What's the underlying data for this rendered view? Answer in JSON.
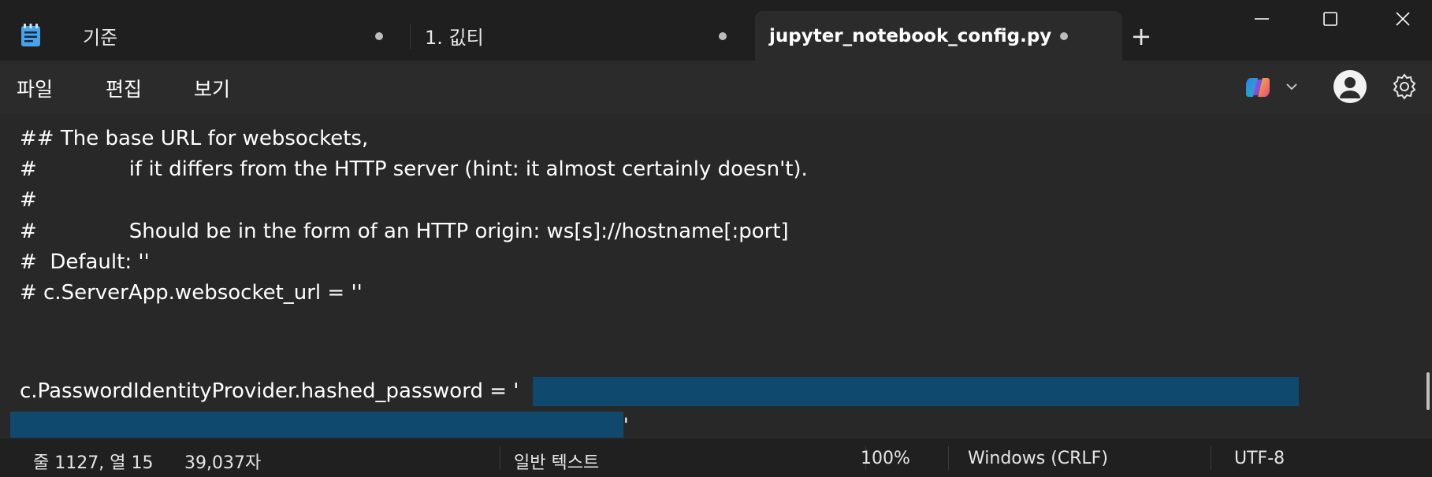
{
  "tabs": [
    {
      "label": "기준"
    },
    {
      "label": "1. 깂티"
    },
    {
      "label": "jupyter_notebook_config.py"
    }
  ],
  "new_tab_label": "+",
  "menu": {
    "file": "파일",
    "edit": "편집",
    "view": "보기"
  },
  "editor": {
    "lines": [
      "## The base URL for websockets,",
      "#",
      "if it differs from the HTTP server (hint: it almost certainly doesn't).",
      "#",
      "#",
      "Should be in the form of an HTTP origin: ws[s]://hostname[:port]",
      "#  Default: ''",
      "# c.ServerApp.websocket_url = ''",
      "c.PasswordIdentityProvider.hashed_password = '",
      "'"
    ]
  },
  "status": {
    "position": "줄 1127, 열 15",
    "char_count": "39,037자",
    "mode": "일반 텍스트",
    "zoom": "100%",
    "line_ending": "Windows (CRLF)",
    "encoding": "UTF-8"
  },
  "colors": {
    "selection": "#0f4a6e",
    "editor_bg": "#282828",
    "menubar_bg": "#2b2b2b",
    "titlebar_bg": "#1f1f1f"
  }
}
